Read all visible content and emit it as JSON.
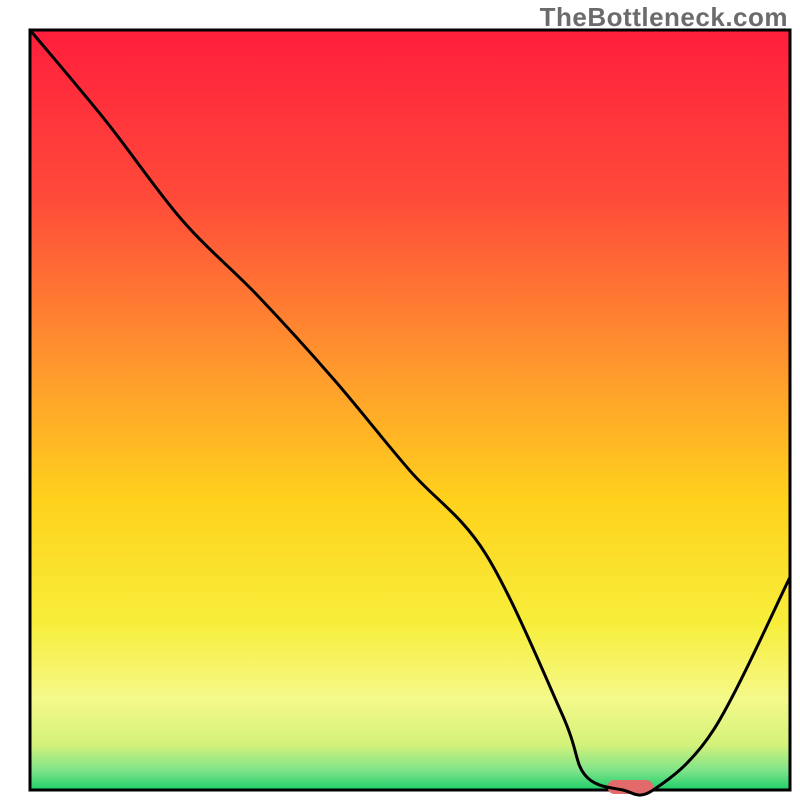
{
  "watermark": "TheBottleneck.com",
  "chart_data": {
    "type": "line",
    "title": "",
    "xlabel": "",
    "ylabel": "",
    "xlim": [
      0,
      100
    ],
    "ylim": [
      0,
      100
    ],
    "x": [
      0,
      10,
      20,
      30,
      40,
      50,
      60,
      70,
      73,
      78,
      82,
      90,
      100
    ],
    "values": [
      100,
      88,
      75,
      65,
      54,
      42,
      31,
      10,
      2,
      0,
      0,
      8,
      28
    ],
    "minimum_marker": {
      "x_start": 76,
      "x_end": 82,
      "y": 0
    },
    "gradient_stops": [
      {
        "offset": 0.0,
        "color": "#ff1e3c"
      },
      {
        "offset": 0.22,
        "color": "#ff4a3a"
      },
      {
        "offset": 0.45,
        "color": "#ff9a2d"
      },
      {
        "offset": 0.62,
        "color": "#ffd21c"
      },
      {
        "offset": 0.78,
        "color": "#f7ee3a"
      },
      {
        "offset": 0.88,
        "color": "#f5f98a"
      },
      {
        "offset": 0.94,
        "color": "#d4f27a"
      },
      {
        "offset": 0.975,
        "color": "#7de38a"
      },
      {
        "offset": 1.0,
        "color": "#1ccf68"
      }
    ],
    "marker_color": "#e26a6a",
    "curve_color": "#000000",
    "frame_color": "#000000"
  }
}
